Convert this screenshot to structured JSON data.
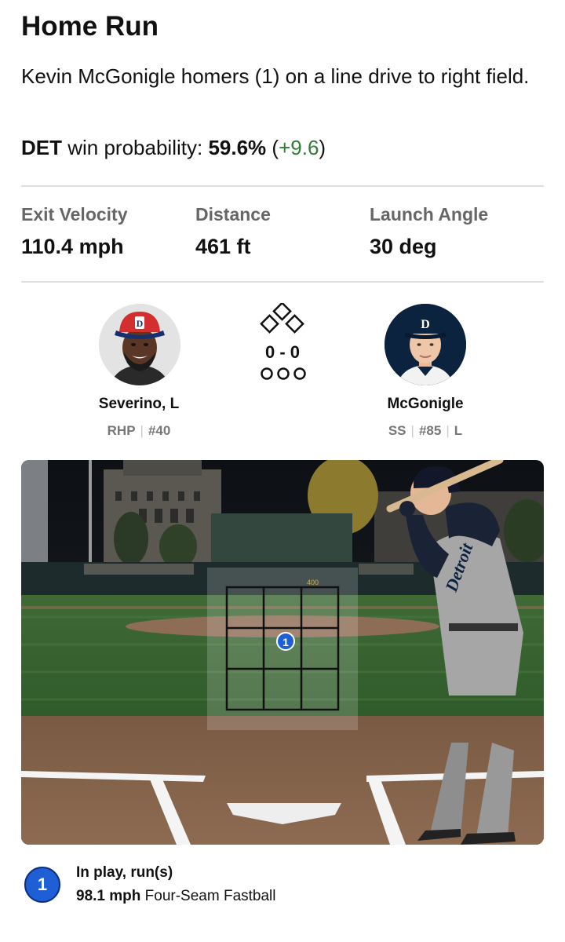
{
  "play": {
    "title": "Home Run",
    "description": "Kevin McGonigle homers (1) on a line drive to right field."
  },
  "win_probability": {
    "team": "DET",
    "label": "win probability:",
    "value": "59.6%",
    "delta": "+9.6",
    "delta_color": "#2e7d32"
  },
  "stats": [
    {
      "label": "Exit Velocity",
      "value": "110.4 mph"
    },
    {
      "label": "Distance",
      "value": "461 ft"
    },
    {
      "label": "Launch Angle",
      "value": "30 deg"
    }
  ],
  "pitcher": {
    "name": "Severino, L",
    "position": "RHP",
    "number": "#40",
    "cap_color": "#d32f2f",
    "cap_letter": "D"
  },
  "batter": {
    "name": "McGonigle",
    "position": "SS",
    "number": "#85",
    "bats": "L",
    "cap_color": "#0c2340",
    "cap_letter": "D"
  },
  "situation": {
    "count": "0 - 0",
    "bases_icon": "bases-diamond-icon",
    "outs_icon": "outs-circles-icon"
  },
  "strike_zone": {
    "wall_marker": "400",
    "pitch_number": "1",
    "zone_color": "#1f5fd6"
  },
  "pitch_legend": {
    "number": "1",
    "result": "In play, run(s)",
    "speed": "98.1 mph",
    "pitch_type": "Four-Seam Fastball"
  }
}
